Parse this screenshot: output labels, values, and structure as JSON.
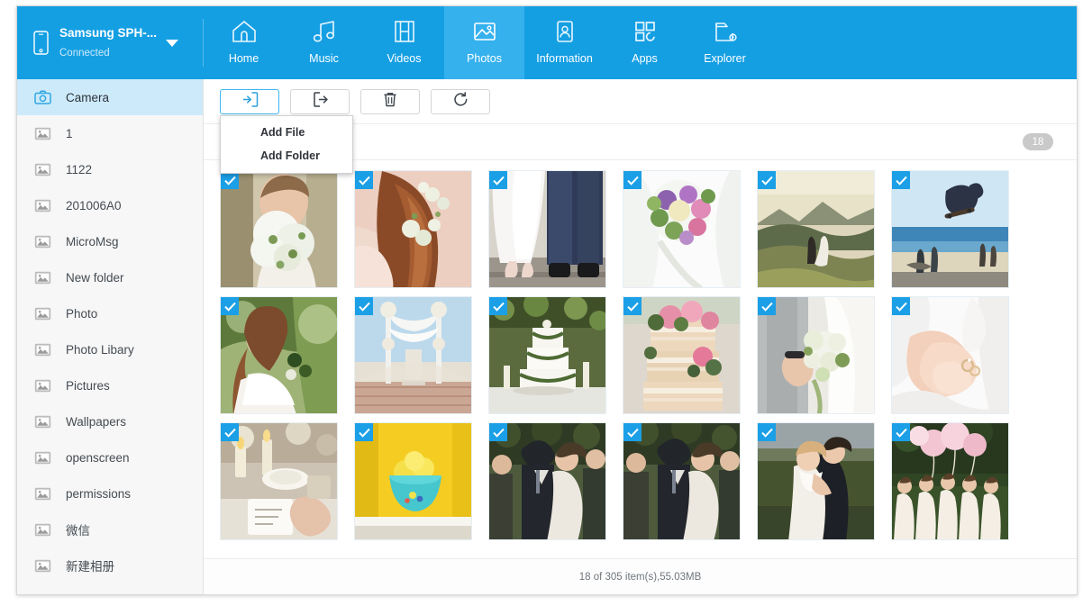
{
  "header": {
    "device": {
      "icon": "phone-icon",
      "name": "Samsung SPH-...",
      "status": "Connected",
      "caret": "chevron-down-icon"
    },
    "tabs": [
      {
        "label": "Home",
        "icon": "home-icon",
        "active": false
      },
      {
        "label": "Music",
        "icon": "music-note-icon",
        "active": false
      },
      {
        "label": "Videos",
        "icon": "film-icon",
        "active": false
      },
      {
        "label": "Photos",
        "icon": "photo-icon",
        "active": true
      },
      {
        "label": "Information",
        "icon": "contact-card-icon",
        "active": false
      },
      {
        "label": "Apps",
        "icon": "grid-squares-icon",
        "active": false
      },
      {
        "label": "Explorer",
        "icon": "folder-gear-icon",
        "active": false
      }
    ]
  },
  "sidebar": {
    "items": [
      {
        "label": "Camera",
        "icon": "camera-icon",
        "active": true
      },
      {
        "label": "1",
        "icon": "image-icon",
        "active": false
      },
      {
        "label": "1122",
        "icon": "image-icon",
        "active": false
      },
      {
        "label": "201006A0",
        "icon": "image-icon",
        "active": false
      },
      {
        "label": "MicroMsg",
        "icon": "image-icon",
        "active": false
      },
      {
        "label": "New folder",
        "icon": "image-icon",
        "active": false
      },
      {
        "label": "Photo",
        "icon": "image-icon",
        "active": false
      },
      {
        "label": "Photo Libary",
        "icon": "image-icon",
        "active": false
      },
      {
        "label": "Pictures",
        "icon": "image-icon",
        "active": false
      },
      {
        "label": "Wallpapers",
        "icon": "image-icon",
        "active": false
      },
      {
        "label": "openscreen",
        "icon": "image-icon",
        "active": false
      },
      {
        "label": "permissions",
        "icon": "image-icon",
        "active": false
      },
      {
        "label": "微信",
        "icon": "image-icon",
        "active": false
      },
      {
        "label": "新建相册",
        "icon": "image-icon",
        "active": false
      }
    ]
  },
  "toolbar": {
    "buttons": [
      {
        "name": "import-button",
        "icon": "import-arrow-into-box-icon",
        "active": true
      },
      {
        "name": "export-button",
        "icon": "export-arrow-out-of-box-icon",
        "active": false
      },
      {
        "name": "delete-button",
        "icon": "trash-icon",
        "active": false
      },
      {
        "name": "refresh-button",
        "icon": "refresh-icon",
        "active": false
      }
    ],
    "dropdown": {
      "open": true,
      "items": [
        "Add File",
        "Add Folder"
      ]
    }
  },
  "content": {
    "count_badge": "18",
    "photos": [
      {
        "alt": "bride-holding-white-bouquet",
        "checked": true
      },
      {
        "alt": "braided-hair-with-flowers",
        "checked": true
      },
      {
        "alt": "couple-feet-bride-groom",
        "checked": true
      },
      {
        "alt": "purple-pink-bouquet-on-dress",
        "checked": true
      },
      {
        "alt": "couple-in-mountain-field",
        "checked": true
      },
      {
        "alt": "skateboarder-jump-at-beach",
        "checked": true
      },
      {
        "alt": "bride-profile-in-green-garden",
        "checked": true
      },
      {
        "alt": "wedding-aisle-with-drapes",
        "checked": true
      },
      {
        "alt": "tiered-white-wedding-cake",
        "checked": true
      },
      {
        "alt": "naked-cake-with-roses",
        "checked": true
      },
      {
        "alt": "groom-and-bride-with-bouquet",
        "checked": true
      },
      {
        "alt": "hands-holding-wedding-rings",
        "checked": true
      },
      {
        "alt": "table-setting-with-candles",
        "checked": true
      },
      {
        "alt": "lemons-in-teal-bowl-yellow-wall",
        "checked": true
      },
      {
        "alt": "wedding-party-celebration-1",
        "checked": true
      },
      {
        "alt": "wedding-party-celebration-2",
        "checked": true
      },
      {
        "alt": "couple-embracing-in-field",
        "checked": true
      },
      {
        "alt": "bridesmaids-with-balloons",
        "checked": true
      }
    ]
  },
  "statusbar": {
    "text": "18 of 305 item(s),55.03MB"
  },
  "colors": {
    "header_blue": "#159fe3",
    "active_tab_blue": "#35b1ee",
    "sidebar_active": "#cdeafb",
    "check_blue": "#1b9fe6",
    "badge_gray": "#c9c9c9"
  }
}
